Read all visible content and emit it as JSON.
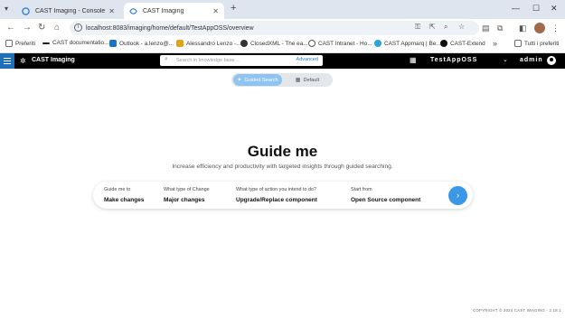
{
  "browser": {
    "tabs": [
      {
        "title": "CAST Imaging - Console",
        "active": false
      },
      {
        "title": "CAST Imaging",
        "active": true
      }
    ],
    "url": "localhost:8083/imaging/home/default/TestAppOSS/overview",
    "bookmarks": [
      {
        "label": "Preferiti",
        "color": "#6b6b6b"
      },
      {
        "label": "CAST documentatio...",
        "color": "#222222"
      },
      {
        "label": "Outlook - a.lenzo@...",
        "color": "#1a73c8"
      },
      {
        "label": "Alessandro Lenzo -...",
        "color": "#e3a21a"
      },
      {
        "label": "ClosedXML - The ea...",
        "color": "#333333"
      },
      {
        "label": "CAST Intranet - Ho...",
        "color": "#555555"
      },
      {
        "label": "CAST Appmarq | Be...",
        "color": "#2aa3d8"
      },
      {
        "label": "CAST-Extend",
        "color": "#111111"
      }
    ],
    "bookmarks_all": "Tutti i preferiti"
  },
  "app": {
    "brand": "CAST Imaging",
    "search": {
      "placeholder": "Search in knowledge base ...",
      "advanced": "Advanced"
    },
    "application": "TestAppOSS",
    "user": "admin",
    "accent": "#1f6fb8"
  },
  "mode_toggle": {
    "guided": "Guided Search",
    "default": "Default"
  },
  "hero": {
    "title": "Guide me",
    "subtitle": "Increase efficiency and productivity with targeted insights through guided searching."
  },
  "guide": {
    "steps": [
      {
        "label": "Guide me to",
        "value": "Make changes"
      },
      {
        "label": "What type of Change",
        "value": "Major changes"
      },
      {
        "label": "What type of action you intend to do?",
        "value": "Upgrade/Replace component"
      },
      {
        "label": "Start from",
        "value": "Open Source component"
      }
    ]
  },
  "footer": {
    "copyright": "COPYRIGHT © 2024 CAST IMAGING - 2.18.1"
  }
}
